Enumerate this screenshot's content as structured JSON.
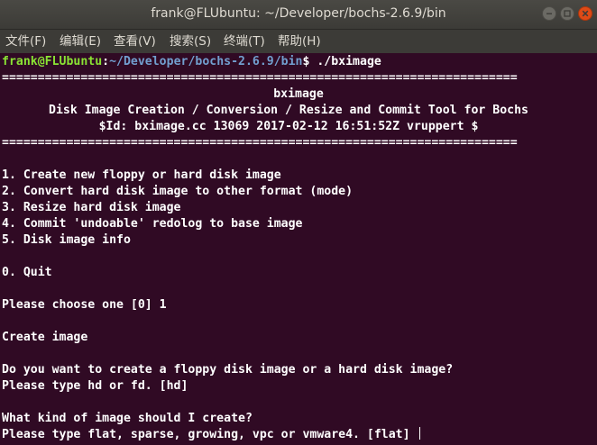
{
  "window": {
    "title": "frank@FLUbuntu: ~/Developer/bochs-2.6.9/bin"
  },
  "menu": {
    "file": "文件(F)",
    "edit": "编辑(E)",
    "view": "查看(V)",
    "search": "搜索(S)",
    "terminal": "终端(T)",
    "help": "帮助(H)"
  },
  "terminal": {
    "prompt_user": "frank@FLUbuntu",
    "prompt_sep": ":",
    "prompt_path": "~/Developer/bochs-2.6.9/bin",
    "prompt_cmd": "$ ./bximage",
    "separator_line": "========================================================================",
    "header_title": "bximage",
    "header_subtitle": "Disk Image Creation / Conversion / Resize and Commit Tool for Bochs",
    "header_id": "$Id: bximage.cc 13069 2017-02-12 16:51:52Z vruppert $",
    "menu_options": [
      "1. Create new floppy or hard disk image",
      "2. Convert hard disk image to other format (mode)",
      "3. Resize hard disk image",
      "4. Commit 'undoable' redolog to base image",
      "5. Disk image info"
    ],
    "quit_option": "0. Quit",
    "choose_prompt": "Please choose one [0] 1",
    "create_heading": "Create image",
    "q1": "Do you want to create a floppy disk image or a hard disk image?",
    "q1_hint": "Please type hd or fd. [hd]",
    "q2": "What kind of image should I create?",
    "q2_hint": "Please type flat, sparse, growing, vpc or vmware4. [flat] "
  }
}
